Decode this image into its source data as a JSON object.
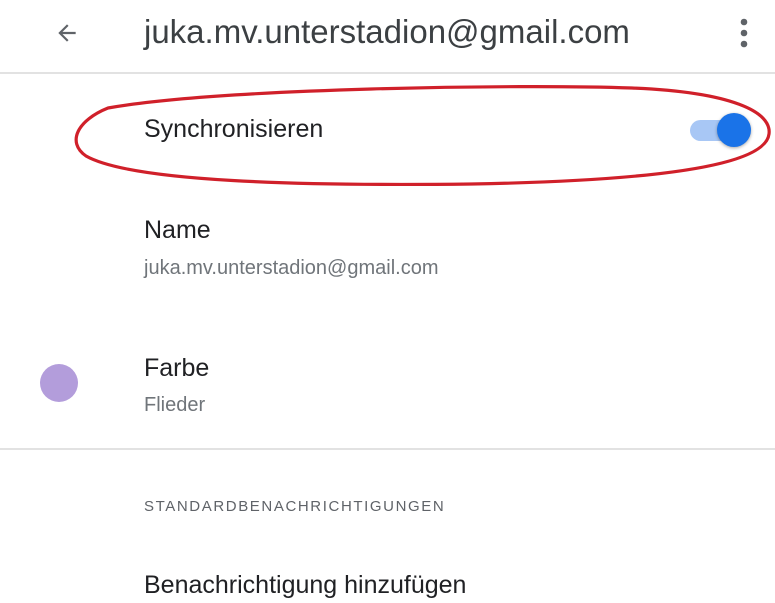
{
  "app_bar": {
    "back_icon": "arrow-back-icon",
    "title": "juka.mv.unterstadion@gmail.com",
    "more_icon": "more-vert-icon"
  },
  "sync": {
    "label": "Synchronisieren",
    "enabled": true,
    "toggle_track_color": "#a8c7f5",
    "toggle_thumb_color": "#1a73e8",
    "highlight_color": "#d0202a"
  },
  "name": {
    "label": "Name",
    "value": "juka.mv.unterstadion@gmail.com"
  },
  "color": {
    "label": "Farbe",
    "value": "Flieder",
    "swatch_hex": "#b39ddb"
  },
  "notifications_section": {
    "header": "STANDARDBENACHRICHTIGUNGEN",
    "add_label": "Benachrichtigung hinzufügen"
  }
}
